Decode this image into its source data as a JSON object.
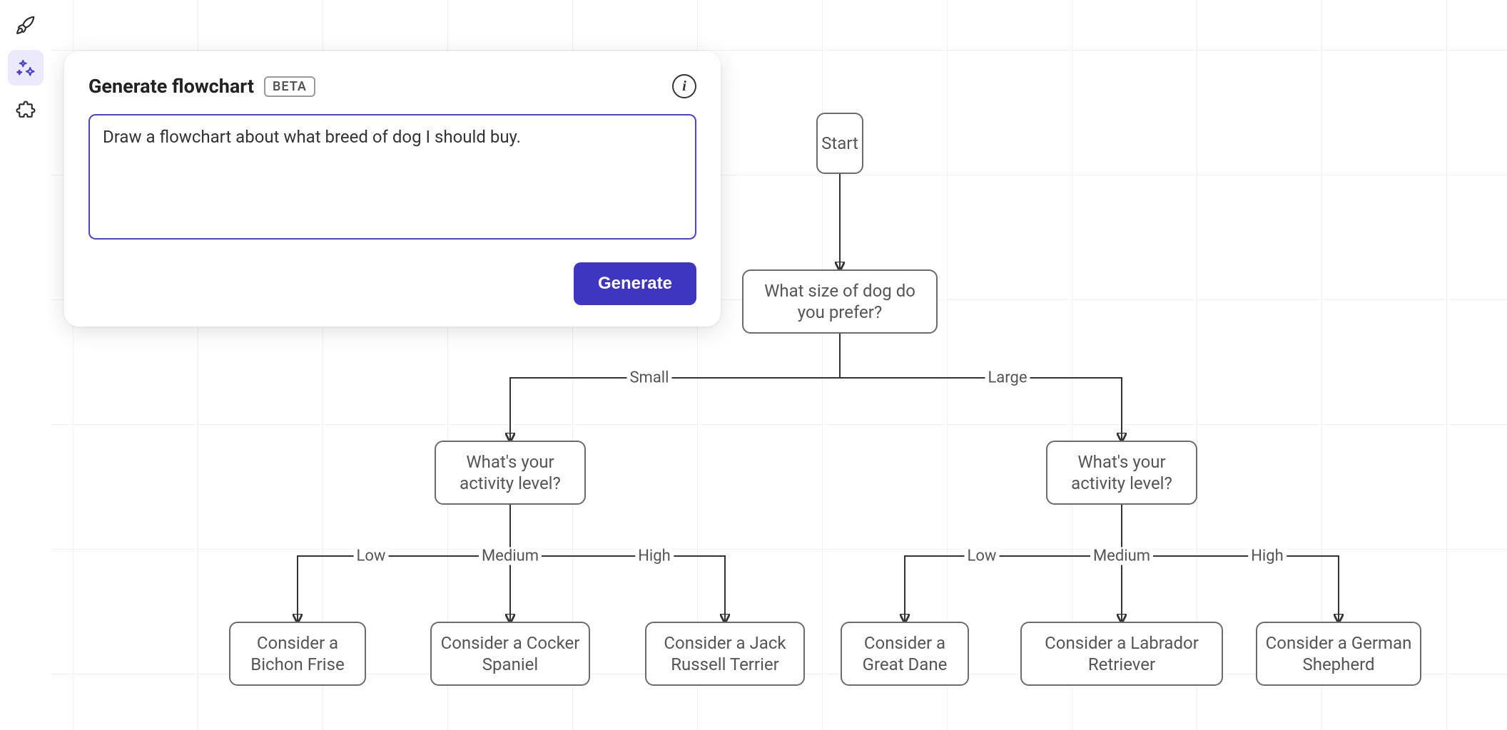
{
  "toolbar": {
    "items": [
      {
        "name": "rocket-icon",
        "active": false
      },
      {
        "name": "sparkle-icon",
        "active": true
      },
      {
        "name": "puzzle-icon",
        "active": false
      }
    ]
  },
  "panel": {
    "title": "Generate flowchart",
    "badge": "BETA",
    "info_symbol": "i",
    "prompt_value": "Draw a flowchart about what breed of dog I should buy.",
    "generate_label": "Generate"
  },
  "flowchart": {
    "nodes": {
      "start": "Start",
      "size": "What size of dog do you prefer?",
      "activity_small": "What's your activity level?",
      "activity_large": "What's your activity level?",
      "bichon": "Consider a Bichon Frise",
      "cocker": "Consider a Cocker Spaniel",
      "jrt": "Consider a Jack Russell Terrier",
      "dane": "Consider a Great Dane",
      "labrador": "Consider a Labrador Retriever",
      "shepherd": "Consider a German Shepherd"
    },
    "edges": {
      "small": "Small",
      "large": "Large",
      "low1": "Low",
      "med1": "Medium",
      "high1": "High",
      "low2": "Low",
      "med2": "Medium",
      "high2": "High"
    }
  }
}
